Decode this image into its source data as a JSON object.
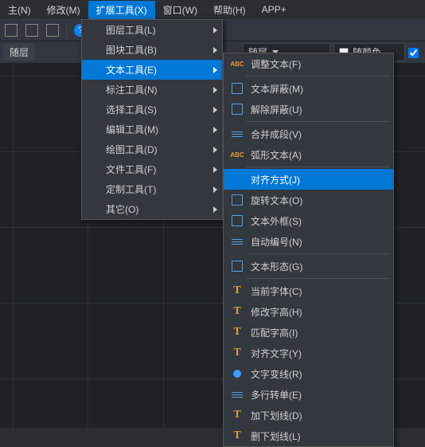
{
  "menubar": {
    "items": [
      {
        "label": "主(N)"
      },
      {
        "label": "修改(M)"
      },
      {
        "label": "扩展工具(X)",
        "active": true
      },
      {
        "label": "窗口(W)"
      },
      {
        "label": "帮助(H)"
      },
      {
        "label": "APP+"
      }
    ]
  },
  "property": {
    "layer_label": "随层",
    "combo1": "随层",
    "combo2": "随颜色"
  },
  "dropdown1": {
    "items": [
      {
        "label": "图层工具(L)",
        "arrow": true
      },
      {
        "label": "图块工具(B)",
        "arrow": true
      },
      {
        "label": "文本工具(E)",
        "arrow": true,
        "hover": true
      },
      {
        "label": "标注工具(N)",
        "arrow": true
      },
      {
        "label": "选择工具(S)",
        "arrow": true
      },
      {
        "label": "编辑工具(M)",
        "arrow": true
      },
      {
        "label": "绘图工具(D)",
        "arrow": true
      },
      {
        "label": "文件工具(F)",
        "arrow": true
      },
      {
        "label": "定制工具(T)",
        "arrow": true
      },
      {
        "label": "其它(O)",
        "arrow": true
      }
    ]
  },
  "submenu": {
    "items": [
      {
        "label": "调整文本(F)",
        "icon": "abc"
      },
      {
        "type": "divider"
      },
      {
        "label": "文本屏蔽(M)",
        "icon": "box"
      },
      {
        "label": "解除屏蔽(U)",
        "icon": "box"
      },
      {
        "type": "divider"
      },
      {
        "label": "合并成段(V)",
        "icon": "lines"
      },
      {
        "label": "弧形文本(A)",
        "icon": "abc"
      },
      {
        "type": "divider"
      },
      {
        "label": "对齐方式(J)",
        "icon": "boxfill",
        "hover": true
      },
      {
        "label": "旋转文本(O)",
        "icon": "box"
      },
      {
        "label": "文本外框(S)",
        "icon": "box"
      },
      {
        "label": "自动编号(N)",
        "icon": "lines"
      },
      {
        "type": "divider"
      },
      {
        "label": "文本形态(G)",
        "icon": "box"
      },
      {
        "type": "divider"
      },
      {
        "label": "当前字体(C)",
        "icon": "t"
      },
      {
        "label": "修改字高(H)",
        "icon": "t"
      },
      {
        "label": "匹配字高(I)",
        "icon": "t"
      },
      {
        "label": "对齐文字(Y)",
        "icon": "t"
      },
      {
        "label": "文字变线(R)",
        "icon": "dot"
      },
      {
        "label": "多行转单(E)",
        "icon": "lines"
      },
      {
        "label": "加下划线(D)",
        "icon": "t"
      },
      {
        "label": "删下划线(L)",
        "icon": "t"
      }
    ]
  }
}
